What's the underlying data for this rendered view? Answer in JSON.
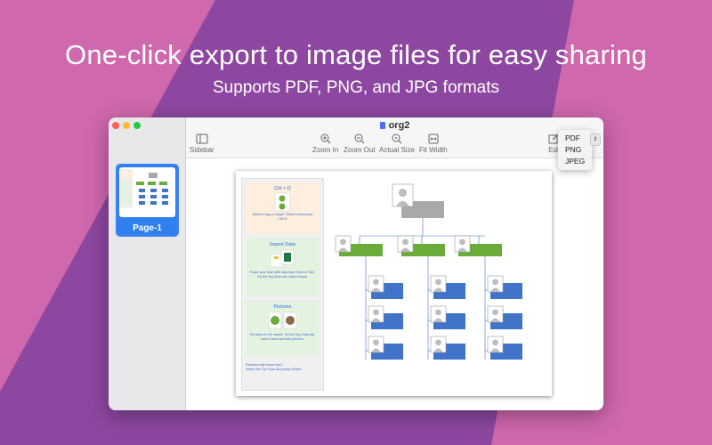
{
  "headline": "One-click export to image files for easy sharing",
  "subheadline": "Supports PDF, PNG, and JPG formats",
  "colors": {
    "pink": "#cf68ad",
    "purple": "#8d47a0",
    "accent": "#2f80ed",
    "org_green": "#6aac3a",
    "org_blue": "#3f74c9",
    "org_gray": "#a9a9a9"
  },
  "window": {
    "title": "org2"
  },
  "sidebar": {
    "page_label": "Page-1"
  },
  "toolbar": {
    "sidebar": "Sidebar",
    "zoom_in": "Zoom In",
    "zoom_out": "Zoom Out",
    "actual_size": "Actual Size",
    "fit_width": "Fit Width",
    "edit": "Edi"
  },
  "export_menu": {
    "options": [
      "PDF",
      "PNG",
      "JPEG"
    ]
  },
  "tips": [
    {
      "title": "Ctrl + D",
      "description": "Need to copy a shape? Select it and press Ctrl+D"
    },
    {
      "title": "Import Data",
      "description": "Power your chart with data from Excel or SQL. On the Org Chart tab, select Import."
    },
    {
      "title": "Pictures",
      "description": "Put faces to the names. On the Org Chart tab, select Insert and add pictures."
    }
  ],
  "tips_footer": "Finished with these tips?\nSelect the Tip Pane and press Delete"
}
